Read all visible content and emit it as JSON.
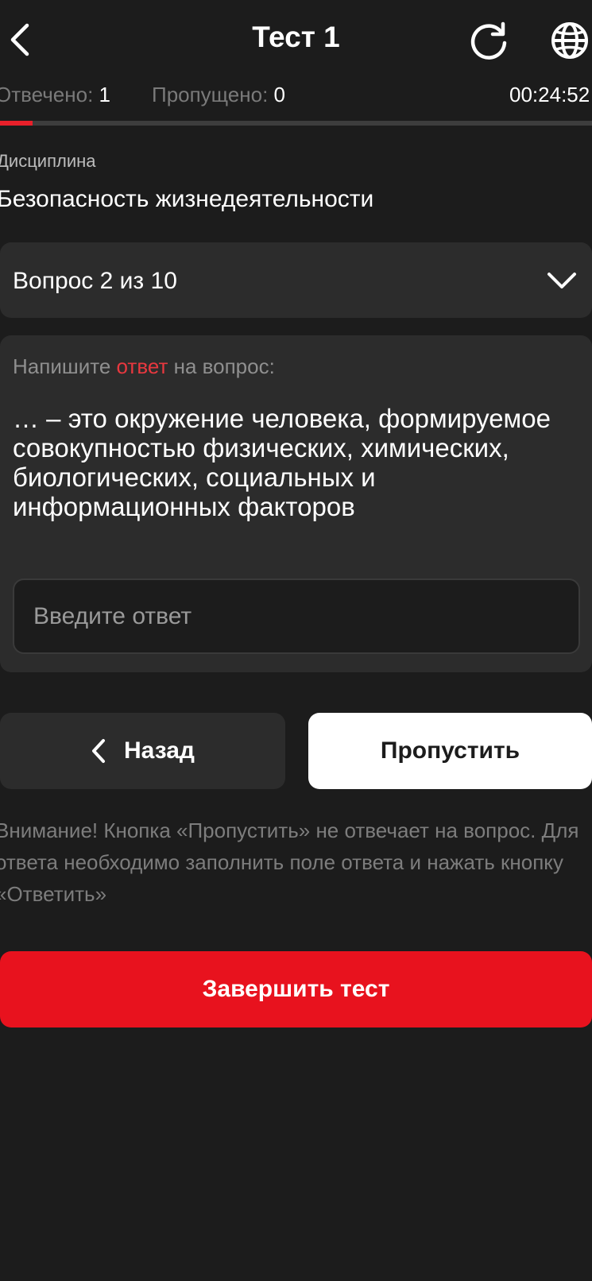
{
  "header": {
    "title": "Тест 1",
    "back_icon": "chevron-left-icon",
    "refresh_icon": "refresh-icon",
    "language_icon": "globe-icon"
  },
  "stats": {
    "answered_label": "Отвечено:",
    "answered_value": "1",
    "skipped_label": "Пропущено:",
    "skipped_value": "0",
    "timer": "00:24:52"
  },
  "progress": {
    "fraction": 0.055
  },
  "discipline": {
    "label": "Дисциплина",
    "value": "Безопасность жизнедеятельности"
  },
  "question_selector": {
    "label": "Вопрос 2 из 10",
    "icon": "chevron-down-icon"
  },
  "question": {
    "prompt_before": "Напишите ",
    "prompt_accent": "ответ",
    "prompt_after": " на вопрос:",
    "text": "… – это окружение человека, формируемое совокупностью физических, химических, биологических, социальных и информационных факторов",
    "answer_value": "",
    "answer_placeholder": "Введите ответ"
  },
  "buttons": {
    "back_label": "Назад",
    "skip_label": "Пропустить",
    "finish_label": "Завершить тест"
  },
  "warning": {
    "text": "Внимание! Кнопка «Пропустить» не отвечает на вопрос. Для ответа необходимо заполнить поле ответа и нажать кнопку «Ответить»"
  },
  "colors": {
    "background": "#1c1c1c",
    "card": "#2c2c2c",
    "accent": "#e8121e",
    "muted_text": "#7a7a7a"
  }
}
